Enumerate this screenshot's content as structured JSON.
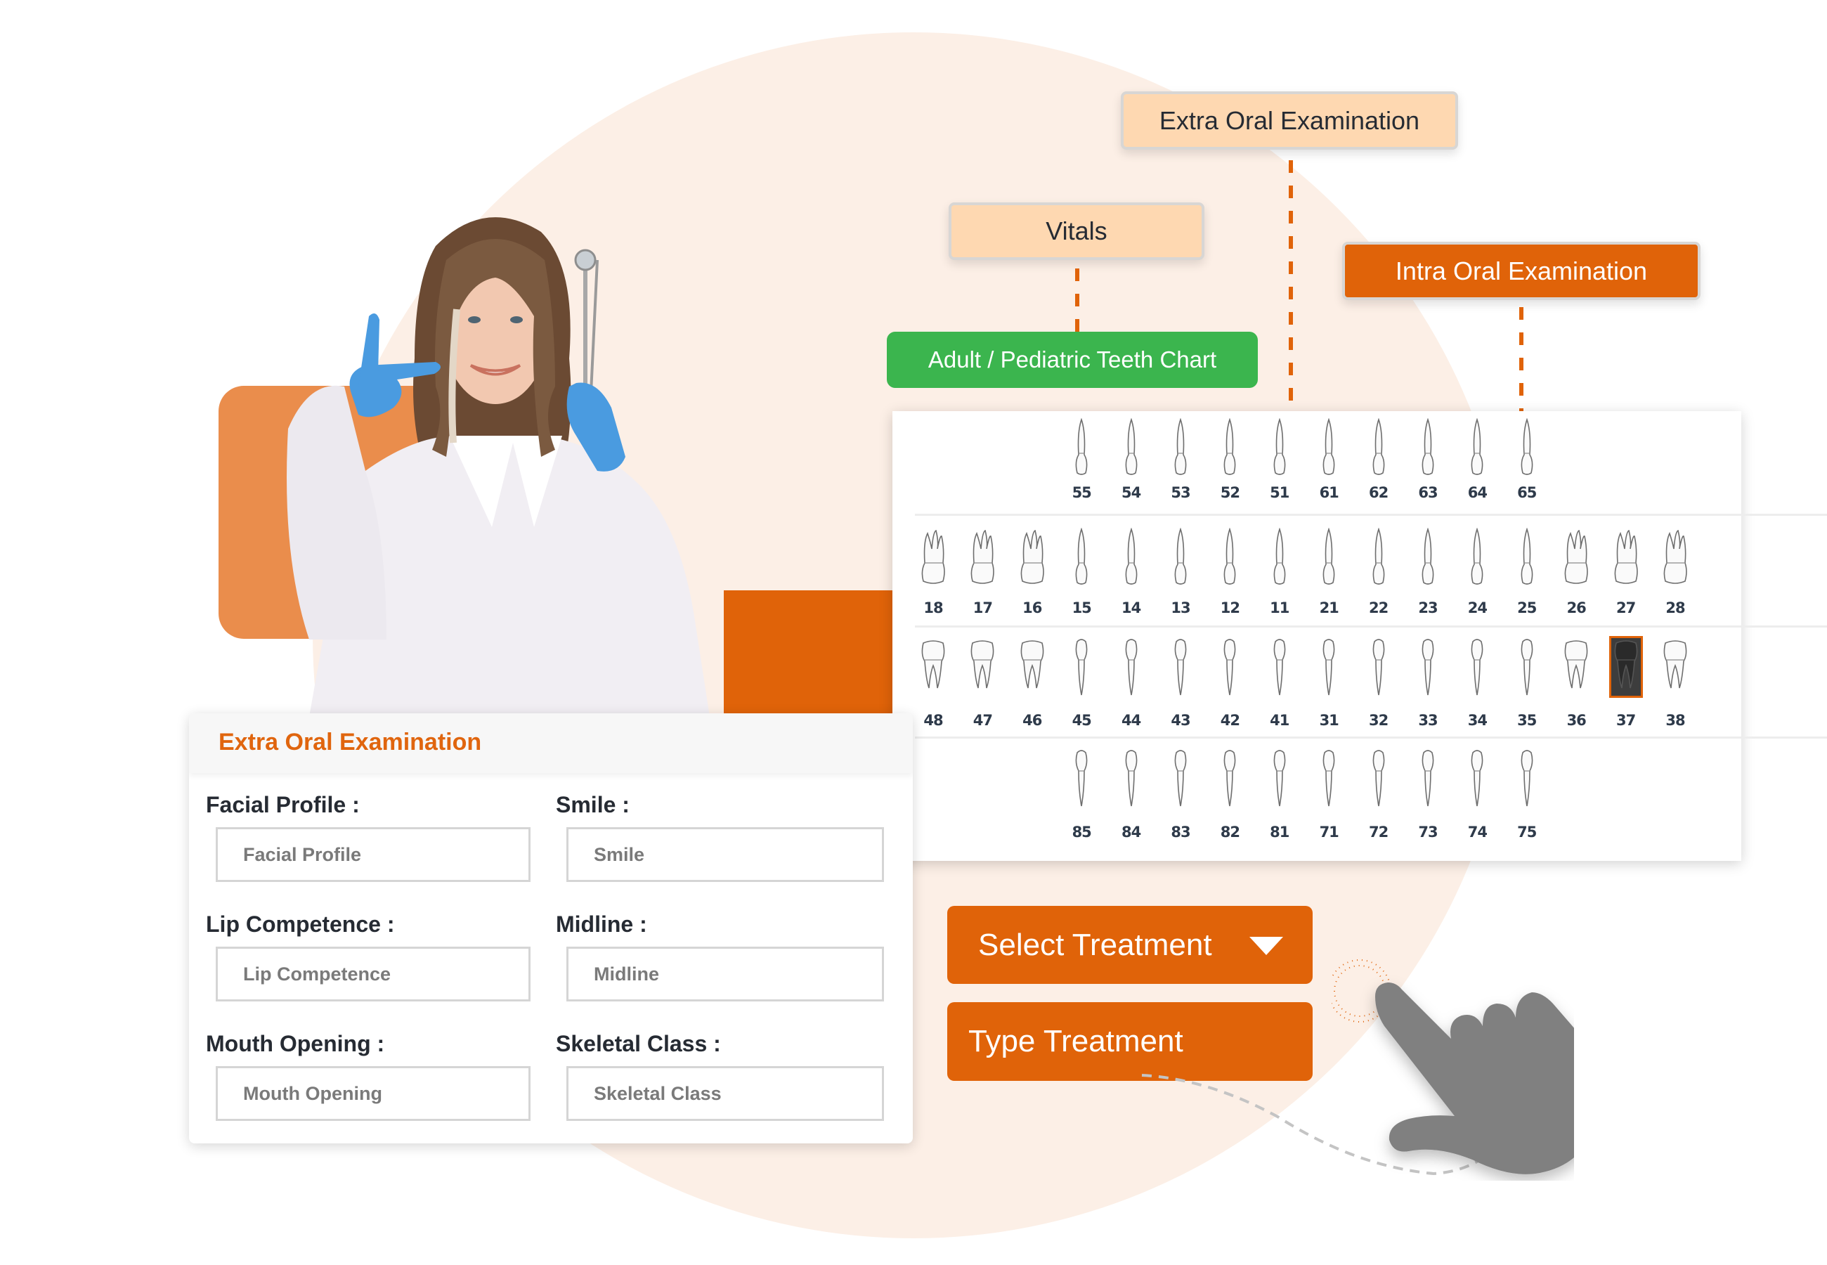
{
  "tags": {
    "extra_oral": "Extra Oral Examination",
    "vitals": "Vitals",
    "intra_oral": "Intra Oral Examination",
    "teeth_chart": "Adult / Pediatric Teeth Chart"
  },
  "teeth_chart": {
    "selected_tooth": "37",
    "rows": [
      {
        "name": "primary-upper",
        "teeth": [
          "55",
          "54",
          "53",
          "52",
          "51",
          "61",
          "62",
          "63",
          "64",
          "65"
        ]
      },
      {
        "name": "permanent-upper",
        "teeth": [
          "18",
          "17",
          "16",
          "15",
          "14",
          "13",
          "12",
          "11",
          "21",
          "22",
          "23",
          "24",
          "25",
          "26",
          "27",
          "28"
        ]
      },
      {
        "name": "permanent-lower",
        "teeth": [
          "48",
          "47",
          "46",
          "45",
          "44",
          "43",
          "42",
          "41",
          "31",
          "32",
          "33",
          "34",
          "35",
          "36",
          "37",
          "38"
        ]
      },
      {
        "name": "primary-lower",
        "teeth": [
          "85",
          "84",
          "83",
          "82",
          "81",
          "71",
          "72",
          "73",
          "74",
          "75"
        ]
      }
    ]
  },
  "form": {
    "title": "Extra Oral Examination",
    "fields": [
      {
        "label": "Facial Profile :",
        "placeholder": "Facial Profile"
      },
      {
        "label": "Smile :",
        "placeholder": "Smile"
      },
      {
        "label": "Lip Competence :",
        "placeholder": "Lip Competence"
      },
      {
        "label": "Midline :",
        "placeholder": "Midline"
      },
      {
        "label": "Mouth Opening :",
        "placeholder": "Mouth Opening"
      },
      {
        "label": "Skeletal Class :",
        "placeholder": "Skeletal Class"
      }
    ]
  },
  "treatment": {
    "select_label": "Select Treatment",
    "type_label": "Type Treatment"
  },
  "colors": {
    "brand_orange": "#E06309",
    "light_orange": "#EA8D4C",
    "peach": "#FED8B1",
    "green": "#3BB54E",
    "background_circle": "#FCEFE6",
    "cursor_gray": "#808080"
  },
  "icons": {
    "dropdown": "triangle-down-icon",
    "cursor": "pointing-hand-icon"
  }
}
